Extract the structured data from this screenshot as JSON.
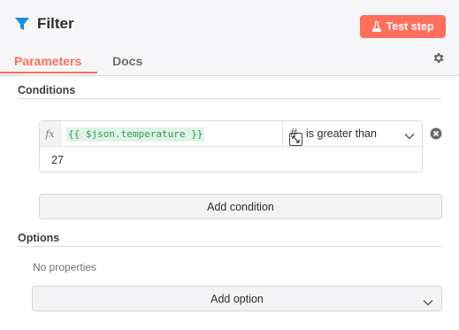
{
  "header": {
    "title": "Filter",
    "test_button": "Test step",
    "tabs": [
      {
        "label": "Parameters",
        "active": true
      },
      {
        "label": "Docs",
        "active": false
      }
    ]
  },
  "conditions": {
    "section_label": "Conditions",
    "items": [
      {
        "fx_label": "fx",
        "left_value": "{{ $json.temperature }}",
        "operator_type_symbol": "#",
        "operator": "is greater than",
        "right_value": "27"
      }
    ],
    "add_button": "Add condition"
  },
  "options": {
    "section_label": "Options",
    "empty_text": "No properties",
    "add_button": "Add option"
  },
  "colors": {
    "accent": "#ff6d5a",
    "title_icon": "#1a8cd8",
    "expression_bg": "#dff3e6",
    "expression_text": "#2e9a57"
  },
  "icons": [
    "filter-icon",
    "beaker-icon",
    "gear-icon",
    "expand-icon",
    "chevron-down-icon",
    "remove-icon"
  ]
}
